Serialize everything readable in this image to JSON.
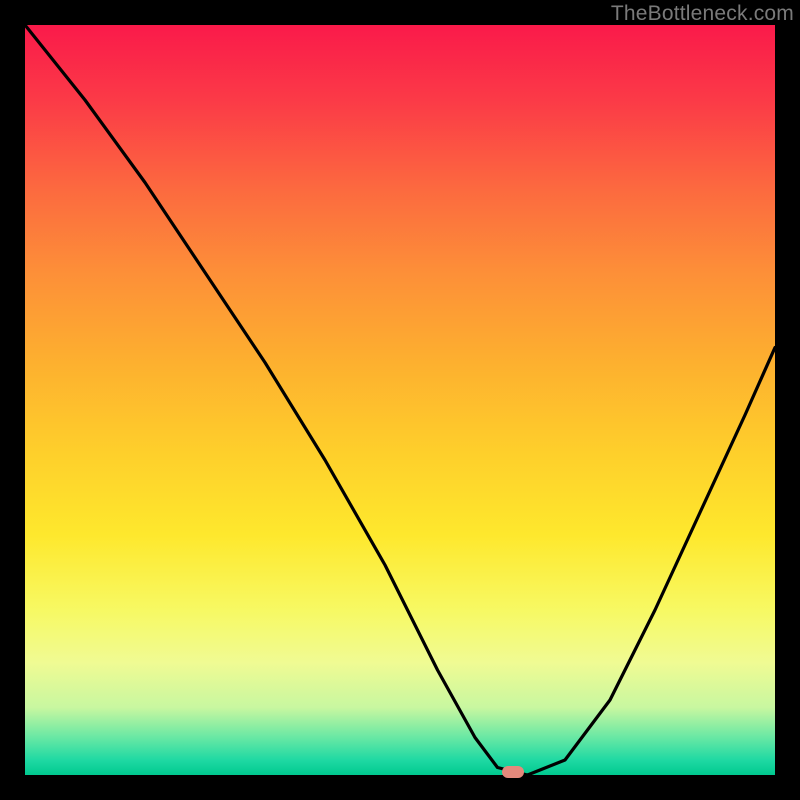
{
  "attribution": "TheBottleneck.com",
  "colors": {
    "page_bg": "#000000",
    "gradient_top": "#fa1a4a",
    "gradient_mid": "#fee82d",
    "gradient_bottom": "#00c98f",
    "curve": "#000000",
    "marker": "#e4897c"
  },
  "chart_data": {
    "type": "line",
    "title": "",
    "xlabel": "",
    "ylabel": "",
    "xlim": [
      0,
      100
    ],
    "ylim": [
      0,
      100
    ],
    "grid": false,
    "legend": false,
    "series": [
      {
        "name": "bottleneck-curve",
        "x": [
          0,
          8,
          16,
          24,
          32,
          40,
          48,
          55,
          60,
          63,
          67,
          72,
          78,
          84,
          90,
          96,
          100
        ],
        "y": [
          100,
          90,
          79,
          67,
          55,
          42,
          28,
          14,
          5,
          1,
          0,
          2,
          10,
          22,
          35,
          48,
          57
        ]
      }
    ],
    "marker": {
      "x": 65,
      "y": 0.4
    },
    "notes": "x/y in 0–100 chart coords; y read as percent of plot height (pixel-estimated from the image)."
  }
}
